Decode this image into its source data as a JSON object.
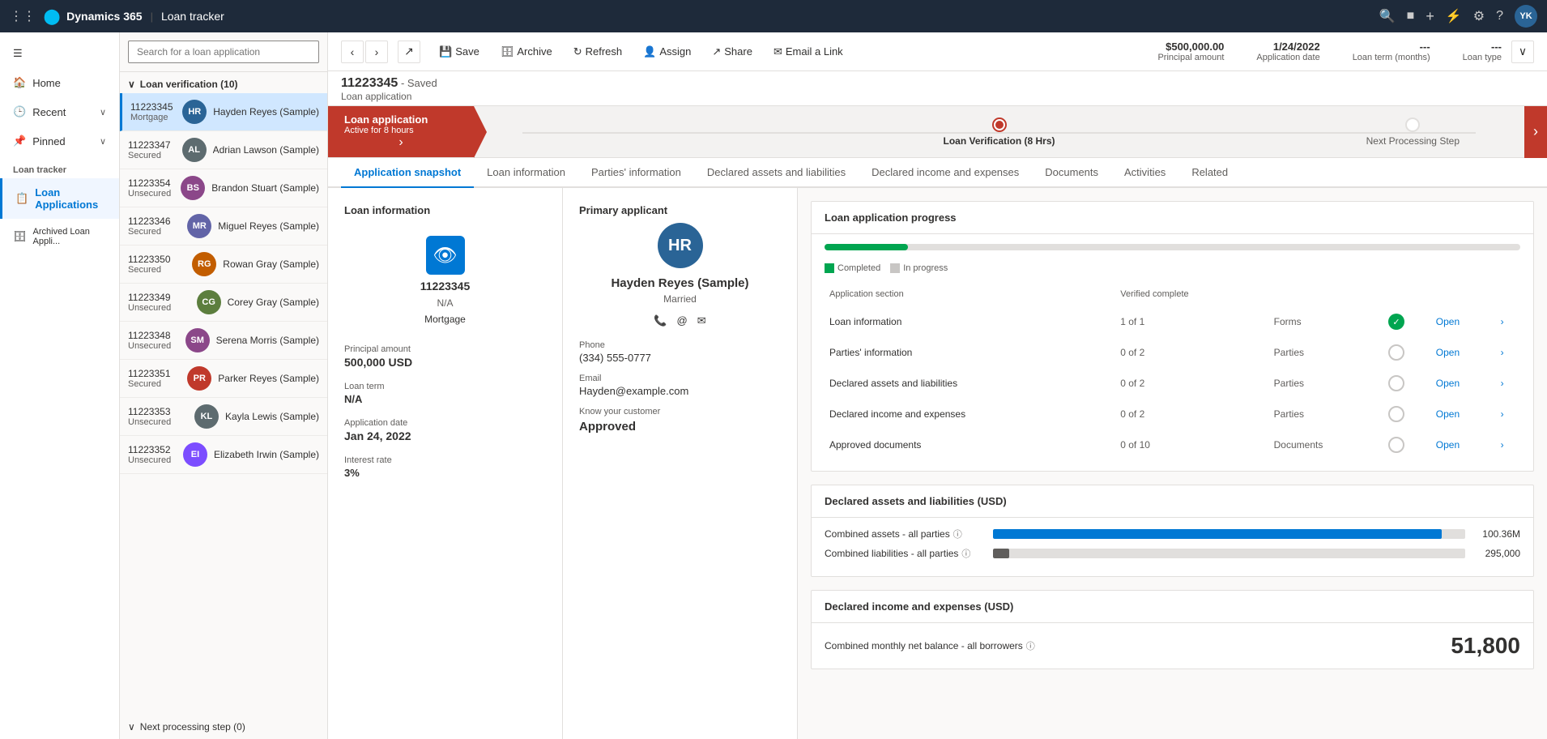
{
  "topbar": {
    "dots": "⋮⋮⋮",
    "logo": "Dynamics 365",
    "separator": "|",
    "app_name": "Loan tracker",
    "icons": [
      "🔍",
      "🔔",
      "+",
      "⚡",
      "⚙",
      "?"
    ],
    "avatar": "YK"
  },
  "sidebar": {
    "items": [
      {
        "id": "home",
        "label": "Home",
        "icon": "🏠"
      },
      {
        "id": "recent",
        "label": "Recent",
        "icon": "🕒",
        "chevron": "∨"
      },
      {
        "id": "pinned",
        "label": "Pinned",
        "icon": "📌",
        "chevron": "∨"
      }
    ],
    "section": "Loan tracker",
    "nav_items": [
      {
        "id": "loan-applications",
        "label": "Loan Applications",
        "active": true
      },
      {
        "id": "archived",
        "label": "Archived Loan Appli..."
      }
    ]
  },
  "list_panel": {
    "search_placeholder": "Search for a loan application",
    "group_header": "Loan verification (10)",
    "items": [
      {
        "id": "11223345",
        "type": "Mortgage",
        "name": "Hayden Reyes (Sample)",
        "initials": "HR",
        "color": "#2a6496",
        "selected": true
      },
      {
        "id": "11223347",
        "type": "Secured",
        "name": "Adrian Lawson (Sample)",
        "initials": "AL",
        "color": "#5d6b6f"
      },
      {
        "id": "11223354",
        "type": "Unsecured",
        "name": "Brandon Stuart (Sample)",
        "initials": "BS",
        "color": "#8b4789"
      },
      {
        "id": "11223346",
        "type": "Secured",
        "name": "Miguel Reyes (Sample)",
        "initials": "MR",
        "color": "#6264a7"
      },
      {
        "id": "11223350",
        "type": "Secured",
        "name": "Rowan Gray (Sample)",
        "initials": "RG",
        "color": "#c25d00"
      },
      {
        "id": "11223349",
        "type": "Unsecured",
        "name": "Corey Gray (Sample)",
        "initials": "CG",
        "color": "#5c7e3e"
      },
      {
        "id": "11223348",
        "type": "Unsecured",
        "name": "Serena Morris (Sample)",
        "initials": "SM",
        "color": "#8b4789"
      },
      {
        "id": "11223351",
        "type": "Secured",
        "name": "Parker Reyes (Sample)",
        "initials": "PR",
        "color": "#c0392b"
      },
      {
        "id": "11223353",
        "type": "Unsecured",
        "name": "Kayla Lewis (Sample)",
        "initials": "KL",
        "color": "#5d6b6f"
      },
      {
        "id": "11223352",
        "type": "Unsecured",
        "name": "Elizabeth Irwin (Sample)",
        "initials": "EI",
        "color": "#7c4dff"
      }
    ],
    "footer": "Next processing step (0)",
    "footer_icon": "∨"
  },
  "toolbar": {
    "back": "‹",
    "forward": "›",
    "refresh_icon": "↗",
    "save": "Save",
    "archive": "Archive",
    "refresh": "Refresh",
    "assign": "Assign",
    "share": "Share",
    "email_link": "Email a Link",
    "meta": {
      "principal_amount": "$500,000.00",
      "principal_label": "Principal amount",
      "app_date": "1/24/2022",
      "app_date_label": "Application date",
      "loan_term": "---",
      "loan_term_label": "Loan term (months)",
      "loan_type": "---",
      "loan_type_label": "Loan type"
    }
  },
  "record": {
    "id": "11223345",
    "saved": "- Saved",
    "type": "Loan application"
  },
  "process_bar": {
    "stage_label": "Loan application",
    "stage_sub": "Active for 8 hours",
    "active_label": "Loan Verification (8 Hrs)",
    "next_label": "Next Processing Step"
  },
  "tabs": [
    {
      "id": "snapshot",
      "label": "Application snapshot",
      "active": true
    },
    {
      "id": "loan-info",
      "label": "Loan information"
    },
    {
      "id": "parties",
      "label": "Parties' information"
    },
    {
      "id": "assets",
      "label": "Declared assets and liabilities"
    },
    {
      "id": "income",
      "label": "Declared income and expenses"
    },
    {
      "id": "documents",
      "label": "Documents"
    },
    {
      "id": "activities",
      "label": "Activities"
    },
    {
      "id": "related",
      "label": "Related"
    }
  ],
  "loan_info_card": {
    "title": "Loan information",
    "app_id": "11223345",
    "na": "N/A",
    "mortgage": "Mortgage",
    "principal_label": "Principal amount",
    "principal": "500,000 USD",
    "loan_term_label": "Loan term",
    "loan_term": "N/A",
    "app_date_label": "Application date",
    "app_date": "Jan 24, 2022",
    "interest_label": "Interest rate",
    "interest": "3%"
  },
  "applicant_card": {
    "title": "Primary applicant",
    "initials": "HR",
    "name": "Hayden Reyes (Sample)",
    "marital_status": "Married",
    "phone_label": "Phone",
    "phone": "(334) 555-0777",
    "email_label": "Email",
    "email": "Hayden@example.com",
    "kyc_label": "Know your customer",
    "kyc_value": "Approved"
  },
  "progress_panel": {
    "title": "Loan application progress",
    "progress_pct": 12,
    "legend": [
      {
        "label": "Completed",
        "color": "#00a550"
      },
      {
        "label": "In progress",
        "color": "#e1dfdd"
      }
    ],
    "col_section": "Application section",
    "col_verified": "Verified complete",
    "rows": [
      {
        "section": "Loan information",
        "progress": "1 of 1",
        "type": "Forms",
        "completed": true
      },
      {
        "section": "Parties' information",
        "progress": "0 of 2",
        "type": "Parties",
        "completed": false
      },
      {
        "section": "Declared assets and liabilities",
        "progress": "0 of 2",
        "type": "Parties",
        "completed": false
      },
      {
        "section": "Declared income and expenses",
        "progress": "0 of 2",
        "type": "Parties",
        "completed": false
      },
      {
        "section": "Approved documents",
        "progress": "0 of 10",
        "type": "Documents",
        "completed": false
      }
    ]
  },
  "assets_panel": {
    "title": "Declared assets and liabilities (USD)",
    "combined_assets_label": "Combined assets - all parties",
    "combined_assets_value": "100.36M",
    "combined_assets_pct": 95,
    "liabilities_label": "Combined liabilities - all parties",
    "liabilities_value": "295,000",
    "liabilities_pct": 5
  },
  "income_panel": {
    "title": "Declared income and expenses (USD)",
    "monthly_label": "Combined monthly net balance - all borrowers",
    "monthly_value": "51,800"
  }
}
